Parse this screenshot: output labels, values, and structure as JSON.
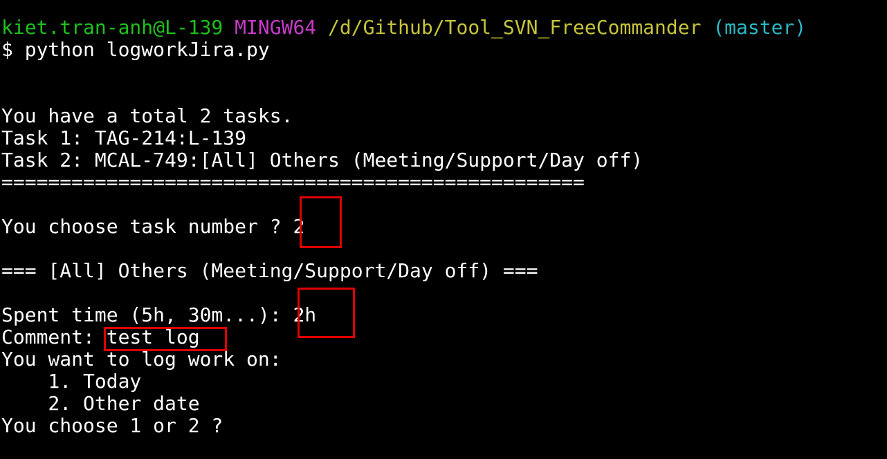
{
  "prompt": {
    "user_host": "kiet.tran-anh@L-139",
    "system": "MINGW64",
    "path": "/d/Github/Tool_SVN_FreeCommander",
    "branch": "(master)",
    "symbol": "$",
    "command": "python logworkJira.py"
  },
  "output": {
    "total": "You have a total 2 tasks.",
    "task1": "Task 1: TAG-214:L-139",
    "task2": "Task 2: MCAL-749:[All] Others (Meeting/Support/Day off)",
    "separator": "==================================================",
    "choose_task_prompt": "You choose task number ? ",
    "choose_task_answer": "2",
    "selected_header": "=== [All] Others (Meeting/Support/Day off) ===",
    "spent_prompt": "Spent time (5h, 30m...): ",
    "spent_answer": "2h",
    "comment_prompt": "Comment: ",
    "comment_answer": "test log",
    "logwork_prompt": "You want to log work on:",
    "option1": "    1. Today",
    "option2": "    2. Other date",
    "choose_option_prompt": "You choose 1 or 2 ?"
  },
  "colors": {
    "background": "#000000",
    "text": "#ffffff",
    "user_host": "#1ec11e",
    "system": "#c93ac9",
    "path": "#c6c43a",
    "branch": "#2ab7c4",
    "highlight_box": "#e00000"
  }
}
